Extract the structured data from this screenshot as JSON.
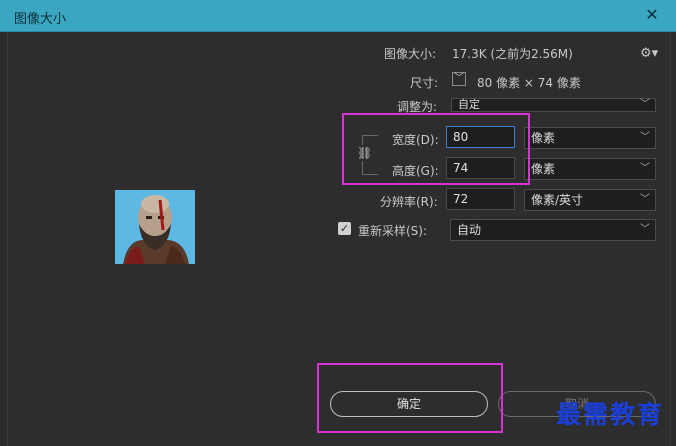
{
  "window": {
    "title": "图像大小"
  },
  "info": {
    "image_size_label": "图像大小:",
    "image_size_value": "17.3K (之前为2.56M)",
    "dimensions_label": "尺寸:",
    "dimensions_value": "80 像素 × 74 像素"
  },
  "fit_to": {
    "label": "调整为:",
    "value": "自定"
  },
  "width": {
    "label": "宽度(D):",
    "value": "80",
    "unit": "像素"
  },
  "height": {
    "label": "高度(G):",
    "value": "74",
    "unit": "像素"
  },
  "resolution": {
    "label": "分辨率(R):",
    "value": "72",
    "unit": "像素/英寸"
  },
  "resample": {
    "label": "重新采样(S):",
    "checked": true,
    "value": "自动"
  },
  "buttons": {
    "ok": "确定",
    "cancel": "取消"
  },
  "watermark": "最需教育",
  "icons": [
    "close-icon",
    "gear-icon",
    "chevron-down-icon",
    "link-chain-icon",
    "checkbox-check-icon"
  ],
  "colors": {
    "titlebar": "#3aa6c1",
    "highlight": "#d633d6",
    "watermark": "#1b3fd6"
  }
}
